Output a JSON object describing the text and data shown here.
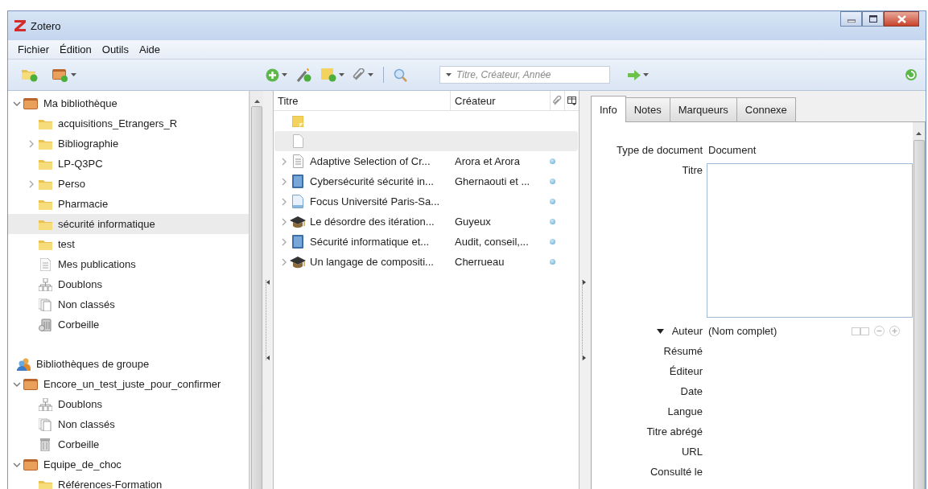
{
  "window": {
    "title": "Zotero"
  },
  "menu": [
    {
      "label": "Fichier"
    },
    {
      "label": "Édition"
    },
    {
      "label": "Outils"
    },
    {
      "label": "Aide"
    }
  ],
  "search": {
    "placeholder": "Titre, Créateur, Année"
  },
  "collections": [
    {
      "kind": "library",
      "label": "Ma bibliothèque",
      "expanded": true,
      "selected": false,
      "children": [
        {
          "kind": "folder",
          "label": "acquisitions_Etrangers_R",
          "selected": false
        },
        {
          "kind": "folder",
          "label": "Bibliographie",
          "expanded": false,
          "selected": false
        },
        {
          "kind": "folder",
          "label": "LP-Q3PC",
          "selected": false
        },
        {
          "kind": "folder",
          "label": "Perso",
          "expanded": false,
          "selected": false
        },
        {
          "kind": "folder",
          "label": "Pharmacie",
          "selected": false
        },
        {
          "kind": "folder",
          "label": "sécurité informatique",
          "selected": true
        },
        {
          "kind": "folder",
          "label": "test",
          "selected": false
        },
        {
          "kind": "publications",
          "label": "Mes publications",
          "selected": false
        },
        {
          "kind": "duplicates",
          "label": "Doublons",
          "selected": false
        },
        {
          "kind": "unfiled",
          "label": "Non classés",
          "selected": false
        },
        {
          "kind": "trash",
          "label": "Corbeille",
          "selected": false
        }
      ]
    },
    {
      "kind": "group-header",
      "label": "Bibliothèques de groupe",
      "selected": false
    },
    {
      "kind": "library",
      "label": "Encore_un_test_juste_pour_confirmer",
      "expanded": true,
      "selected": false,
      "children": [
        {
          "kind": "duplicates",
          "label": "Doublons",
          "selected": false
        },
        {
          "kind": "unfiled",
          "label": "Non classés",
          "selected": false
        },
        {
          "kind": "bin",
          "label": "Corbeille",
          "selected": false
        }
      ]
    },
    {
      "kind": "library",
      "label": "Equipe_de_choc",
      "expanded": true,
      "selected": false,
      "children": [
        {
          "kind": "folder",
          "label": "Références-Formation",
          "selected": false
        }
      ]
    }
  ],
  "items": {
    "columns": [
      {
        "kind": "text",
        "label": "Titre"
      },
      {
        "kind": "text",
        "label": "Créateur"
      },
      {
        "kind": "attachments"
      },
      {
        "kind": "picker"
      }
    ],
    "rows": [
      {
        "kind": "note",
        "selected": false,
        "dot": false
      },
      {
        "kind": "blank",
        "selected": true,
        "dot": false
      },
      {
        "kind": "document",
        "title": "Adaptive Selection of Cr...",
        "creator": "Arora et Arora",
        "expanded": false,
        "selected": false,
        "dot": true
      },
      {
        "kind": "book",
        "title": "Cybersécurité sécurité in...",
        "creator": "Ghernaouti et ...",
        "expanded": false,
        "selected": false,
        "dot": true
      },
      {
        "kind": "report",
        "title": "Focus Université Paris-Sa...",
        "expanded": false,
        "selected": false,
        "dot": true
      },
      {
        "kind": "thesis",
        "title": "Le désordre des itération...",
        "creator": "Guyeux",
        "expanded": false,
        "selected": false,
        "dot": true
      },
      {
        "kind": "book",
        "title": "Sécurité informatique et...",
        "creator": "Audit, conseil,...",
        "expanded": false,
        "selected": false,
        "dot": true
      },
      {
        "kind": "thesis",
        "title": "Un langage de compositi...",
        "creator": "Cherrueau",
        "expanded": false,
        "selected": false,
        "dot": true
      }
    ]
  },
  "tabs": [
    {
      "label": "Info",
      "selected": true
    },
    {
      "label": "Notes",
      "selected": false
    },
    {
      "label": "Marqueurs",
      "selected": false
    },
    {
      "label": "Connexe",
      "selected": false
    }
  ],
  "fields": [
    {
      "kind": "text",
      "label": "Type de document",
      "value": "Document"
    },
    {
      "kind": "textarea",
      "label": "Titre"
    },
    {
      "kind": "creator",
      "label": "Auteur",
      "value": "(Nom complet)",
      "expanded": true
    },
    {
      "kind": "text",
      "label": "Résumé"
    },
    {
      "kind": "text",
      "label": "Éditeur"
    },
    {
      "kind": "text",
      "label": "Date"
    },
    {
      "kind": "text",
      "label": "Langue"
    },
    {
      "kind": "text",
      "label": "Titre abrégé"
    },
    {
      "kind": "text",
      "label": "URL"
    },
    {
      "kind": "text",
      "label": "Consulté le"
    }
  ]
}
